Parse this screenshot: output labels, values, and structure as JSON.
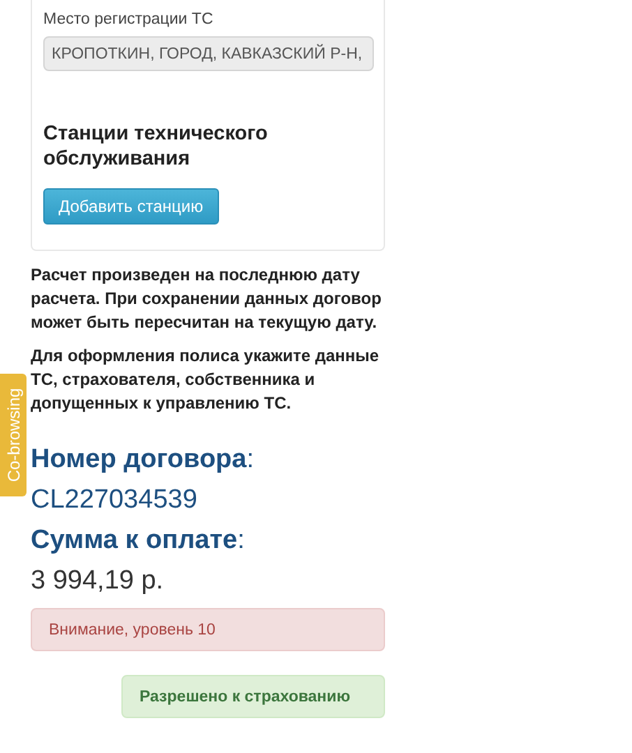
{
  "vehicle_card": {
    "registration_label": "Место регистрации ТС",
    "registration_value": "КРОПОТКИН, ГОРОД, КАВКАЗСКИЙ Р-Н,",
    "stations_heading": "Станции технического обслуживания",
    "add_station_button": "Добавить станцию"
  },
  "notes": [
    "Расчет произведен на последнюю дату расчета. При сохранении данных договор может быть пересчитан на текущую дату.",
    "Для оформления полиса укажите данные ТС, страхователя, собственника и допущенных к управлению ТС."
  ],
  "contract_number_label": "**Номер договора**:",
  "contract_number": "CL227034539",
  "amount_label": "**Сумма к оплате**:",
  "amount": "3 994,19 р.",
  "alerts": [
    {
      "kind": "danger",
      "text": "Внимание, уровень 10"
    },
    {
      "kind": "success",
      "text": "Разрешено к страхованию"
    }
  ],
  "side_tab": "Co-browsing"
}
